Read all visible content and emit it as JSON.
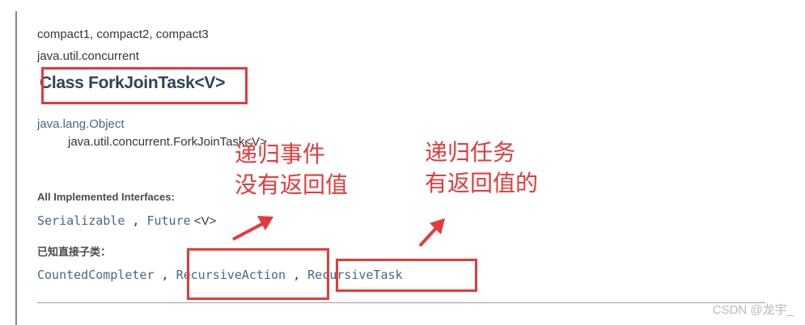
{
  "header": {
    "profiles": "compact1, compact2, compact3",
    "package": "java.util.concurrent",
    "class_title": "Class ForkJoinTask<V>"
  },
  "hierarchy": {
    "parent": "java.lang.Object",
    "child": "java.util.concurrent.ForkJoinTask<V>"
  },
  "implemented": {
    "label": "All Implemented Interfaces:",
    "items": [
      "Serializable",
      "Future"
    ],
    "separator": " , ",
    "generic": " <V>"
  },
  "subclasses": {
    "label": "已知直接子类：",
    "items": [
      "CountedCompleter",
      "RecursiveAction",
      "RecursiveTask"
    ],
    "separator": " , "
  },
  "annotations": {
    "action_note": [
      "递归事件",
      "没有返回值"
    ],
    "task_note": [
      "递归任务",
      "有返回值的"
    ],
    "color": "#e8393a"
  },
  "watermark": "CSDN @龙宇_"
}
